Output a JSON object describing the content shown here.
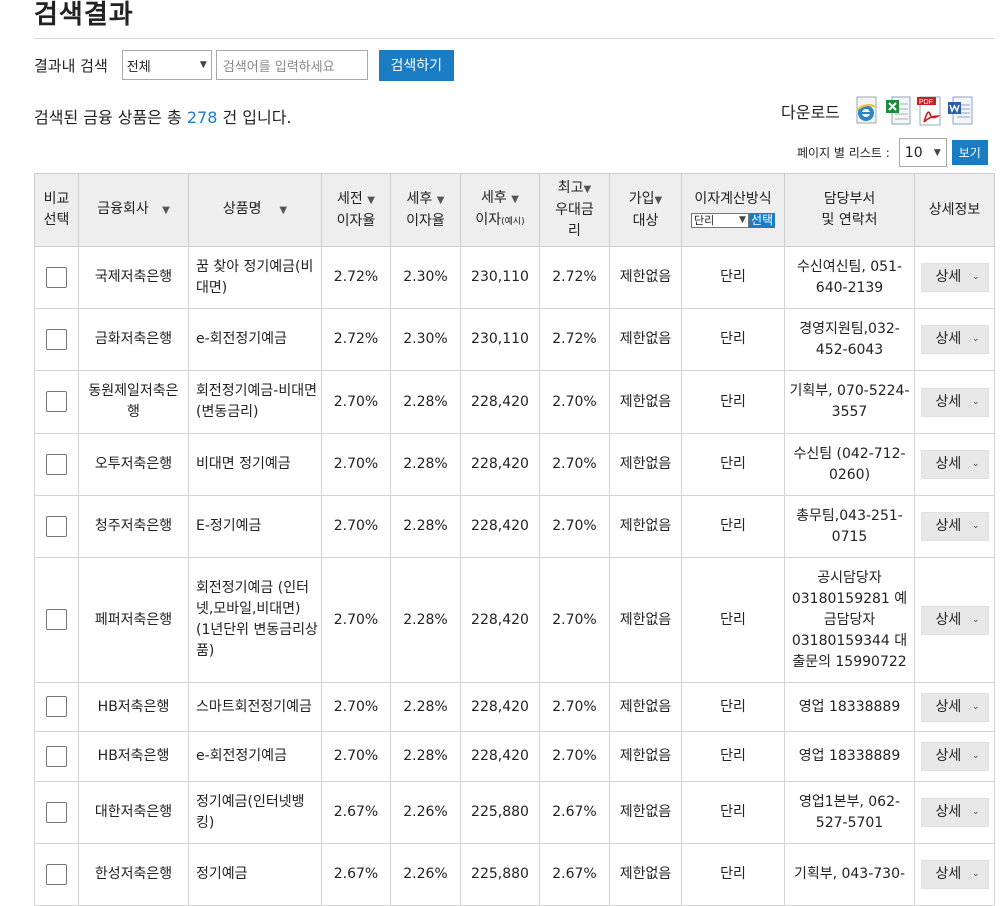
{
  "page": {
    "title": "검색결과"
  },
  "search": {
    "label": "결과내 검색",
    "scope_value": "전체",
    "placeholder": "검색어를 입력하세요",
    "button_label": "검색하기"
  },
  "summary": {
    "prefix": "검색된 금융 상품은 총 ",
    "count": "278",
    "suffix": " 건 입니다."
  },
  "download": {
    "label": "다운로드",
    "icons": [
      "ie-icon",
      "excel-icon",
      "pdf-icon",
      "word-icon"
    ],
    "pdf_text": "PDF"
  },
  "pagination": {
    "label": "페이지 별 리스트 :",
    "value": "10",
    "button": "보기"
  },
  "table": {
    "headers": {
      "compare": [
        "비교",
        "선택"
      ],
      "company": "금융회사",
      "product": "상품명",
      "pretax": [
        "세전",
        "이자율"
      ],
      "posttax": [
        "세후",
        "이자율"
      ],
      "interest": [
        "세후",
        "이자",
        "(예시)"
      ],
      "max_rate": [
        "최고",
        "우대금",
        "리"
      ],
      "eligibility": [
        "가입",
        "대상"
      ],
      "calc_method": "이자계산방식",
      "calc_select": "단리",
      "calc_button": "선택",
      "contact": [
        "담당부서",
        "및 연락처"
      ],
      "detail": "상세정보"
    },
    "sort_glyph": "▼",
    "detail_label": "상세",
    "rows": [
      {
        "company": "국제저축은행",
        "product": "꿈 찾아 정기예금(비대면)",
        "pretax": "2.72%",
        "posttax": "2.30%",
        "interest": "230,110",
        "max_rate": "2.72%",
        "eligibility": "제한없음",
        "method": "단리",
        "contact": "수신여신팀, 051-640-2139"
      },
      {
        "company": "금화저축은행",
        "product": "e-회전정기예금",
        "pretax": "2.72%",
        "posttax": "2.30%",
        "interest": "230,110",
        "max_rate": "2.72%",
        "eligibility": "제한없음",
        "method": "단리",
        "contact": "경영지원팀,032-452-6043"
      },
      {
        "company": "동원제일저축은행",
        "product": "회전정기예금-비대면(변동금리)",
        "pretax": "2.70%",
        "posttax": "2.28%",
        "interest": "228,420",
        "max_rate": "2.70%",
        "eligibility": "제한없음",
        "method": "단리",
        "contact": "기획부, 070-5224-3557"
      },
      {
        "company": "오투저축은행",
        "product": "비대면 정기예금",
        "pretax": "2.70%",
        "posttax": "2.28%",
        "interest": "228,420",
        "max_rate": "2.70%",
        "eligibility": "제한없음",
        "method": "단리",
        "contact": "수신팀 (042-712-0260)"
      },
      {
        "company": "청주저축은행",
        "product": "E-정기예금",
        "pretax": "2.70%",
        "posttax": "2.28%",
        "interest": "228,420",
        "max_rate": "2.70%",
        "eligibility": "제한없음",
        "method": "단리",
        "contact": "총무팀,043-251-0715"
      },
      {
        "company": "페퍼저축은행",
        "product": "회전정기예금 (인터넷,모바일,비대면) (1년단위 변동금리상품)",
        "pretax": "2.70%",
        "posttax": "2.28%",
        "interest": "228,420",
        "max_rate": "2.70%",
        "eligibility": "제한없음",
        "method": "단리",
        "contact": "공시담당자 03180159281 예금담당자 03180159344 대출문의 15990722"
      },
      {
        "company": "HB저축은행",
        "product": "스마트회전정기예금",
        "pretax": "2.70%",
        "posttax": "2.28%",
        "interest": "228,420",
        "max_rate": "2.70%",
        "eligibility": "제한없음",
        "method": "단리",
        "contact": "영업 18338889"
      },
      {
        "company": "HB저축은행",
        "product": "e-회전정기예금",
        "pretax": "2.70%",
        "posttax": "2.28%",
        "interest": "228,420",
        "max_rate": "2.70%",
        "eligibility": "제한없음",
        "method": "단리",
        "contact": "영업 18338889"
      },
      {
        "company": "대한저축은행",
        "product": "정기예금(인터넷뱅킹)",
        "pretax": "2.67%",
        "posttax": "2.26%",
        "interest": "225,880",
        "max_rate": "2.67%",
        "eligibility": "제한없음",
        "method": "단리",
        "contact": "영업1본부, 062-527-5701"
      },
      {
        "company": "한성저축은행",
        "product": "정기예금",
        "pretax": "2.67%",
        "posttax": "2.26%",
        "interest": "225,880",
        "max_rate": "2.67%",
        "eligibility": "제한없음",
        "method": "단리",
        "contact": "기획부, 043-730-"
      }
    ]
  }
}
